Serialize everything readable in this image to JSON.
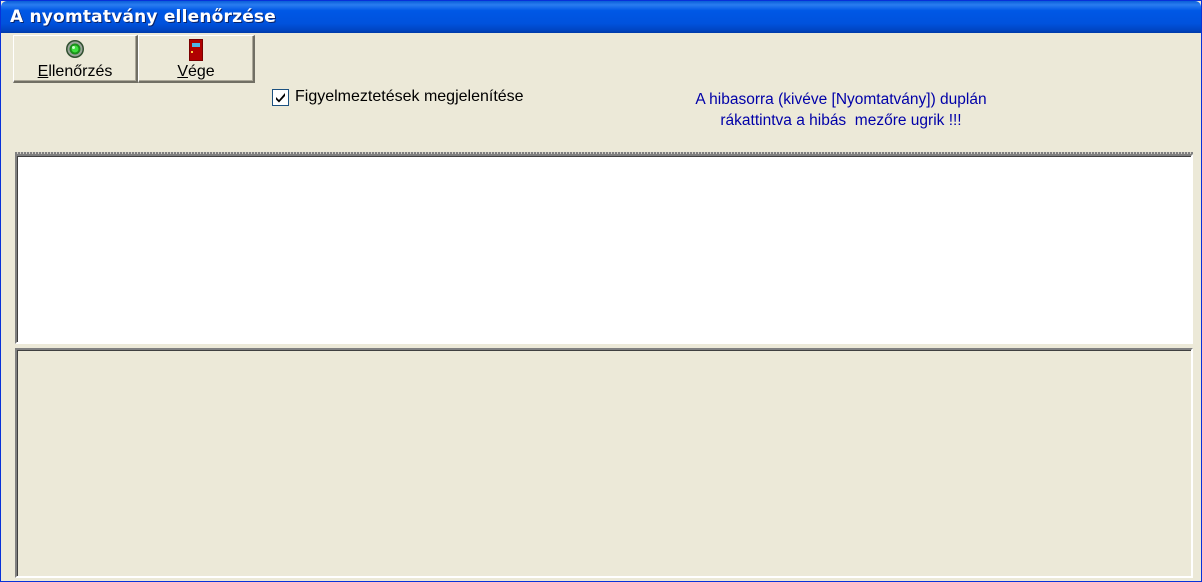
{
  "window": {
    "title": "A nyomtatvány ellenőrzése"
  },
  "toolbar": {
    "check_button": {
      "label_first": "E",
      "label_rest": "llenőrzés",
      "icon": "green-light-icon"
    },
    "end_button": {
      "label_first": "V",
      "label_rest": "ége",
      "icon": "exit-door-icon"
    },
    "warnings_checkbox": {
      "label": "Figyelmeztetések megjelenítése",
      "checked": true
    },
    "hint_line1": "A hibasorra (kivéve [Nyomtatvány]) duplán",
    "hint_line2": "rákattintva a hibás  mezőre ugrik !!!"
  },
  "colors": {
    "titlebar": "#0054e3",
    "hint_text": "#0000a8",
    "window_bg": "#ece9d8"
  }
}
